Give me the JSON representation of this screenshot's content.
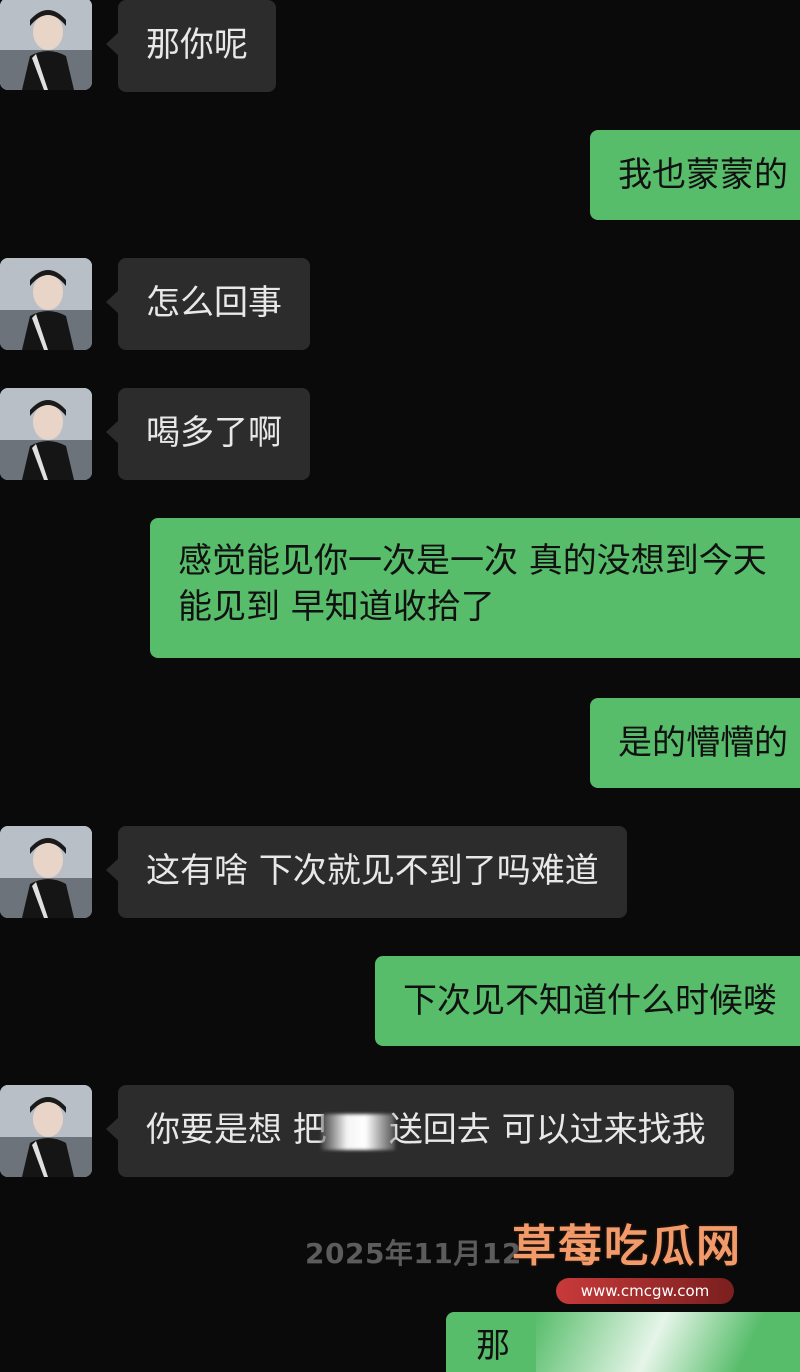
{
  "messages": [
    {
      "side": "in",
      "text": "那你呢"
    },
    {
      "side": "out",
      "text": "我也蒙蒙的"
    },
    {
      "side": "in",
      "text": "怎么回事"
    },
    {
      "side": "in",
      "text": "喝多了啊"
    },
    {
      "side": "out",
      "line1": "感觉能见你一次是一次 真的没想到今天",
      "line2": "能见到 早知道收拾了"
    },
    {
      "side": "out",
      "text": "是的懵懵的"
    },
    {
      "side": "in",
      "text": "这有啥 下次就见不到了吗难道"
    },
    {
      "side": "out",
      "text": "下次见不知道什么时候喽"
    },
    {
      "side": "in",
      "text_before": "你要是想 把",
      "text_after": "送回去 可以过来找我"
    }
  ],
  "timestamp": "2025年11月12",
  "partial_message": "那",
  "watermark": {
    "title": "草莓吃瓜网",
    "url": "www.cmcgw.com"
  },
  "colors": {
    "background": "#0a0a0a",
    "incoming_bubble": "#2c2c2c",
    "outgoing_bubble": "#57bd6a"
  }
}
